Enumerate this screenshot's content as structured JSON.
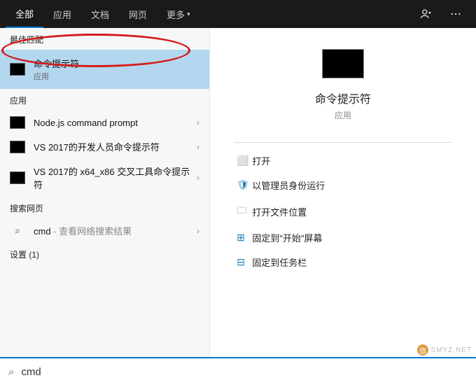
{
  "tabs": {
    "all": "全部",
    "apps": "应用",
    "docs": "文档",
    "web": "网页",
    "more": "更多"
  },
  "sections": {
    "best": "最佳匹配",
    "apps": "应用",
    "web": "搜索网页",
    "settings": "设置 (1)"
  },
  "best_match": {
    "title": "命令提示符",
    "sub": "应用"
  },
  "app_results": [
    {
      "title": "Node.js command prompt"
    },
    {
      "title": "VS 2017的开发人员命令提示符"
    },
    {
      "title": "VS 2017的 x64_x86 交叉工具命令提示符"
    }
  ],
  "web_result": {
    "query": "cmd",
    "suffix": " - 查看网络搜索结果"
  },
  "preview": {
    "title": "命令提示符",
    "sub": "应用"
  },
  "actions": {
    "open": "打开",
    "run_admin": "以管理员身份运行",
    "open_location": "打开文件位置",
    "pin_start": "固定到\"开始\"屏幕",
    "pin_taskbar": "固定到任务栏"
  },
  "search": {
    "value": "cmd"
  },
  "watermark": "SMYZ.NET",
  "wm_badge": "值"
}
